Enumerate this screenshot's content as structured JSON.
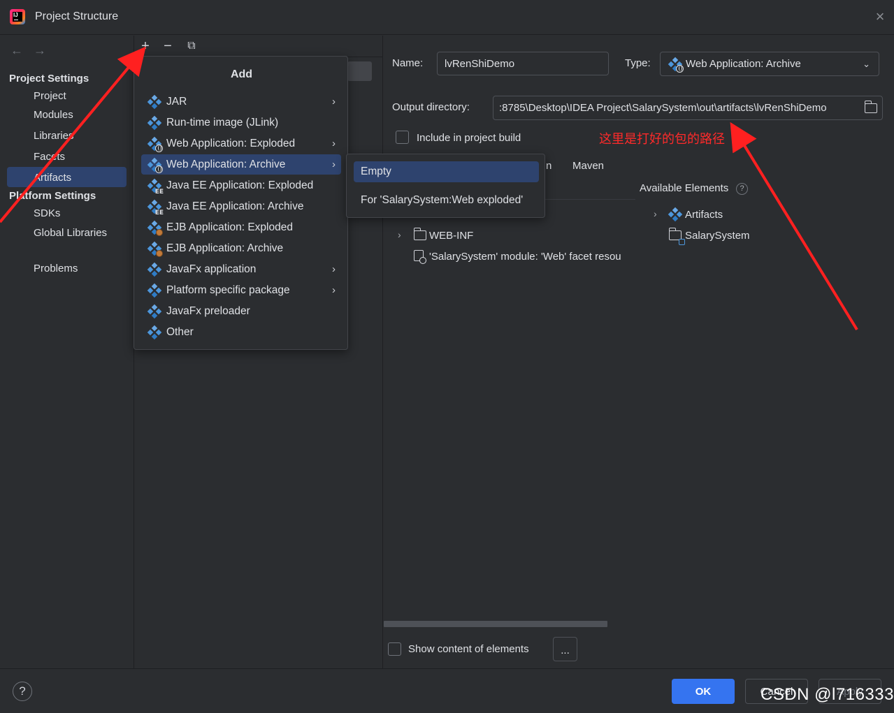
{
  "window": {
    "title": "Project Structure"
  },
  "sidebar": {
    "project_settings_header": "Project Settings",
    "project_items": [
      "Project",
      "Modules",
      "Libraries",
      "Facets",
      "Artifacts"
    ],
    "selected": "Artifacts",
    "platform_settings_header": "Platform Settings",
    "platform_items": [
      "SDKs",
      "Global Libraries"
    ],
    "problems": "Problems"
  },
  "add_popup": {
    "title": "Add",
    "items": [
      {
        "label": "JAR",
        "icon": "artifact-icon",
        "submenu": true
      },
      {
        "label": "Run-time image (JLink)",
        "icon": "artifact-icon",
        "submenu": false
      },
      {
        "label": "Web Application: Exploded",
        "icon": "web-artifact-icon",
        "submenu": true
      },
      {
        "label": "Web Application: Archive",
        "icon": "web-artifact-icon",
        "submenu": true
      },
      {
        "label": "Java EE Application: Exploded",
        "icon": "javaee-artifact-icon",
        "submenu": false
      },
      {
        "label": "Java EE Application: Archive",
        "icon": "javaee-artifact-icon",
        "submenu": false
      },
      {
        "label": "EJB Application: Exploded",
        "icon": "ejb-artifact-icon",
        "submenu": false
      },
      {
        "label": "EJB Application: Archive",
        "icon": "ejb-artifact-icon",
        "submenu": false
      },
      {
        "label": "JavaFx application",
        "icon": "artifact-icon",
        "submenu": true
      },
      {
        "label": "Platform specific package",
        "icon": "artifact-icon",
        "submenu": true
      },
      {
        "label": "JavaFx preloader",
        "icon": "artifact-icon",
        "submenu": false
      },
      {
        "label": "Other",
        "icon": "artifact-icon",
        "submenu": false
      }
    ],
    "selected_index": 3
  },
  "submenu": {
    "items": [
      "Empty",
      "For 'SalarySystem:Web exploded'"
    ],
    "selected_index": 0
  },
  "artifact": {
    "name_label": "Name:",
    "name_value": "lvRenShiDemo",
    "type_label": "Type:",
    "type_value": "Web Application: Archive",
    "output_label": "Output directory:",
    "output_value": ":8785\\Desktop\\IDEA Project\\SalarySystem\\out\\artifacts\\lvRenShiDemo",
    "include_label": "Include in project build",
    "tab_partial": "n",
    "tab_maven": "Maven",
    "available_label": "Available Elements",
    "tree": [
      {
        "label": "WEB-INF"
      },
      {
        "label": "'SalarySystem' module: 'Web' facet resou"
      }
    ],
    "available": [
      {
        "label": "Artifacts"
      },
      {
        "label": "SalarySystem"
      }
    ],
    "show_content_label": "Show content of elements",
    "ellipsis": "..."
  },
  "annotation": {
    "text": "这里是打好的包的路径",
    "color": "#ff2a2a"
  },
  "buttons": {
    "ok": "OK",
    "cancel": "Cancel",
    "apply": "Apply",
    "help": "?"
  },
  "watermark": "CSDN @l716333",
  "colors": {
    "accent": "#3574f0",
    "selection": "#2e436e",
    "background": "#2b2d30"
  }
}
